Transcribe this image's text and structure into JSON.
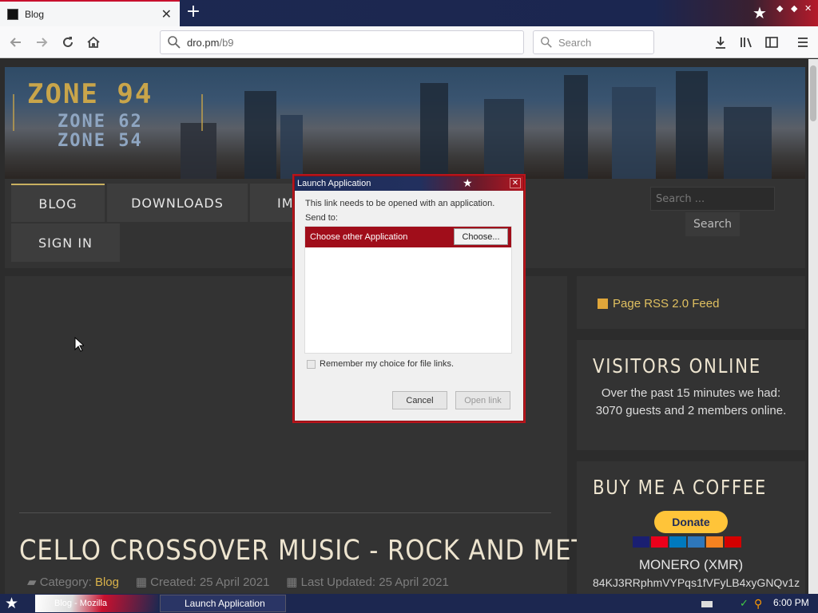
{
  "browser": {
    "tab_title": "Blog",
    "url_host": "dro.pm",
    "url_path": "/b9",
    "search_placeholder": "Search"
  },
  "site": {
    "logo_main": "ZONE 94",
    "logo_sub1": "ZONE 62",
    "logo_sub2": "ZONE 54",
    "menu": {
      "blog": "BLOG",
      "downloads": "DOWNLOADS",
      "partial": "IM",
      "sign_in": "SIGN IN"
    },
    "search_placeholder": "Search ...",
    "search_button": "Search"
  },
  "article": {
    "title": "CELLO CROSSOVER MUSIC - ROCK AND METAL",
    "category_label": "Category:",
    "category": "Blog",
    "created": "Created: 25 April 2021",
    "updated": "Last Updated: 25 April 2021"
  },
  "sidebar": {
    "rss": "Page RSS 2.0 Feed",
    "visitors_title": "VISITORS ONLINE",
    "visitors_text": "Over the past 15 minutes we had: 3070 guests and 2 members online.",
    "coffee_title": "BUY ME A COFFEE",
    "donate": "Donate",
    "monero_label": "MONERO (XMR)",
    "monero_address": "84KJ3RRphmVYPqs1fVFyLB4xyGNQv1z"
  },
  "dialog": {
    "title": "Launch Application",
    "message": "This link needs to be opened with an application.",
    "send_to": "Send to:",
    "row_label": "Choose other Application",
    "choose_button": "Choose...",
    "remember": "Remember my choice for file links.",
    "cancel": "Cancel",
    "open_link": "Open link"
  },
  "taskbar": {
    "task1": "Blog - Mozilla",
    "task2": "Launch Application",
    "time": "6:00 PM"
  },
  "colors": {
    "accent_red": "#a00d1a",
    "gold": "#d9b24a",
    "taskbar": "#1c2750"
  }
}
